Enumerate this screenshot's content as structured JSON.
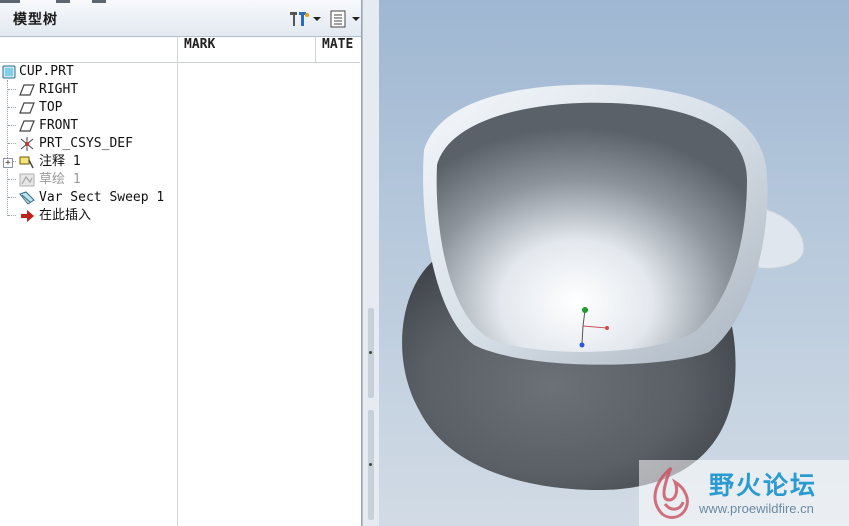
{
  "panel": {
    "title": "模型树",
    "tools": [
      {
        "icon": "settings-tools-icon",
        "has_dropdown": true
      },
      {
        "icon": "show-list-icon",
        "has_dropdown": true
      }
    ]
  },
  "columns": [
    "MARK",
    "MATE"
  ],
  "tree": {
    "items": [
      {
        "label": "CUP.PRT",
        "icon": "part-icon",
        "state": "normal"
      },
      {
        "label": "RIGHT",
        "icon": "datum-plane-icon",
        "state": "normal"
      },
      {
        "label": "TOP",
        "icon": "datum-plane-icon",
        "state": "normal"
      },
      {
        "label": "FRONT",
        "icon": "datum-plane-icon",
        "state": "normal"
      },
      {
        "label": "PRT_CSYS_DEF",
        "icon": "coordinate-system-icon",
        "state": "normal"
      },
      {
        "label": "注释 1",
        "icon": "annotation-icon",
        "state": "collapsed"
      },
      {
        "label": "草绘 1",
        "icon": "sketch-icon",
        "state": "suppressed"
      },
      {
        "label": "Var Sect Sweep 1",
        "icon": "sweep-feature-icon",
        "state": "normal"
      },
      {
        "label": "在此插入",
        "icon": "insert-here-arrow-icon",
        "state": "normal"
      }
    ]
  },
  "viewport": {
    "model": "cup-3d-model",
    "csys_axes": {
      "x": "#d34a4a",
      "y": "#1f9a2e",
      "z": "#2b56d6"
    }
  },
  "watermark": {
    "text": "野火论坛",
    "url": "www.proewildfire.cn"
  },
  "colors": {
    "accent": "#2a9ad0",
    "insert_arrow": "#c0201a"
  }
}
